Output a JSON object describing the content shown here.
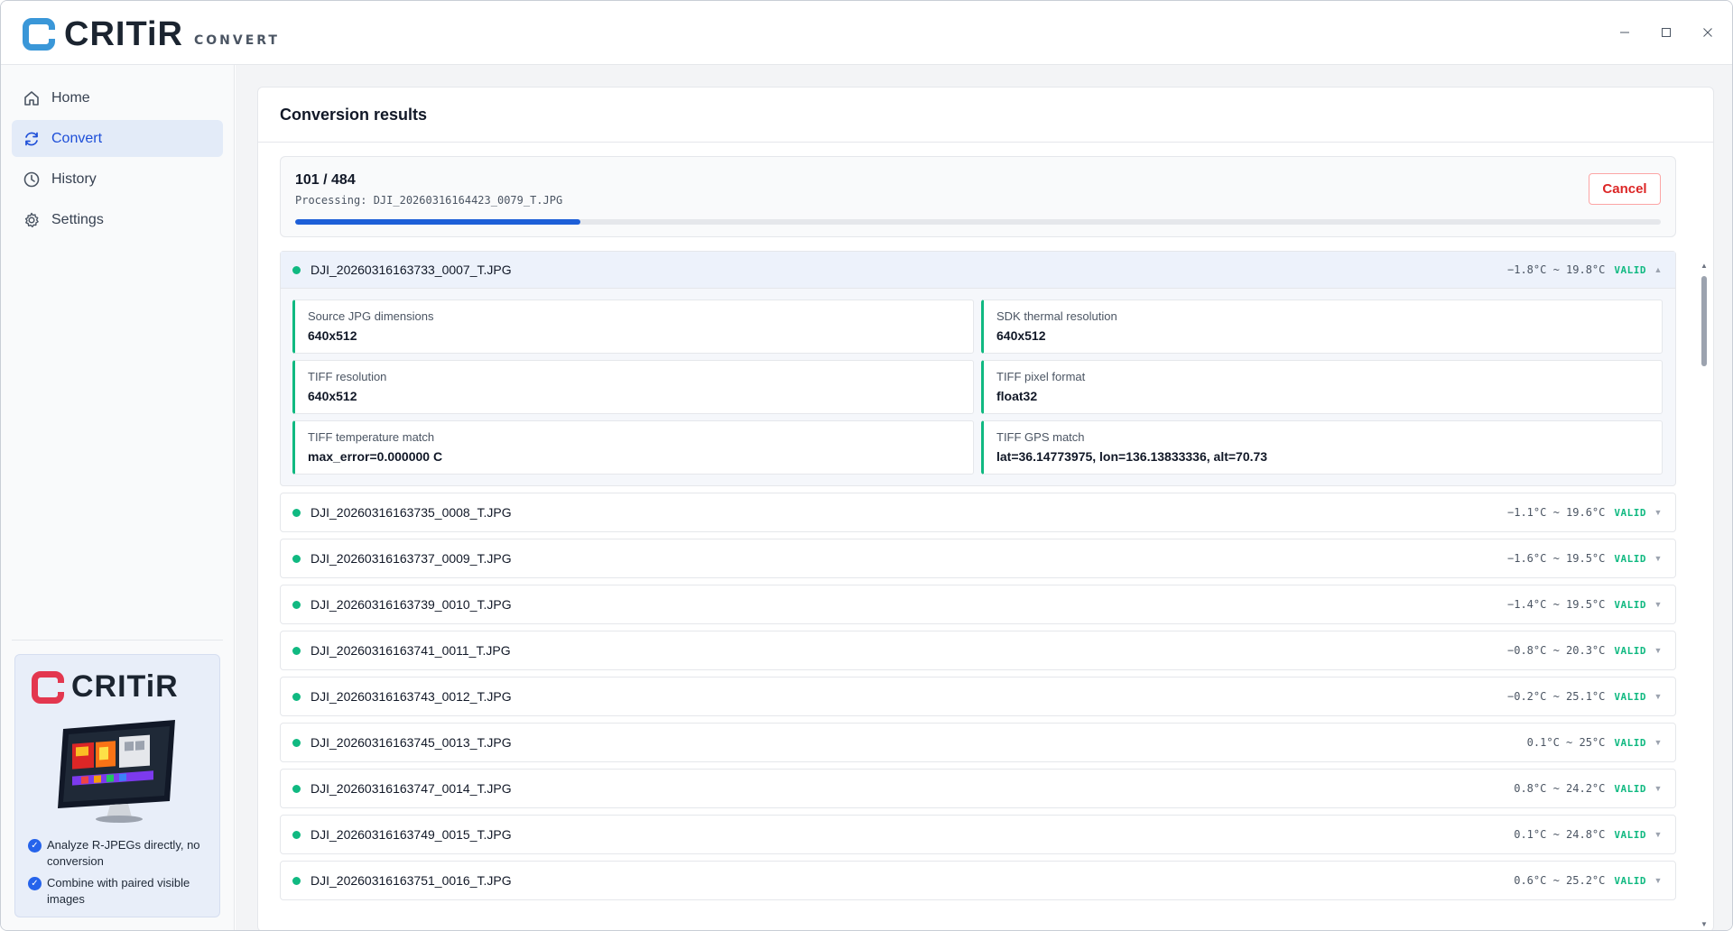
{
  "app": {
    "name": "CRITiR",
    "subtitle": "CONVERT",
    "window_controls": [
      "minimize-icon",
      "maximize-icon",
      "close-icon"
    ]
  },
  "sidebar": {
    "items": [
      {
        "label": "Home",
        "icon": "home-icon",
        "active": false
      },
      {
        "label": "Convert",
        "icon": "refresh-icon",
        "active": true
      },
      {
        "label": "History",
        "icon": "clock-icon",
        "active": false
      },
      {
        "label": "Settings",
        "icon": "gear-icon",
        "active": false
      }
    ],
    "promo": {
      "brand": "CRITiR",
      "features": [
        "Analyze R-JPEGs directly, no conversion",
        "Combine with paired visible images"
      ]
    }
  },
  "main": {
    "title": "Conversion results",
    "progress": {
      "count": "101 / 484",
      "file": "Processing: DJI_20260316164423_0079_T.JPG",
      "fraction": 0.2087,
      "cancel_label": "Cancel"
    },
    "expanded": {
      "file": "DJI_20260316163733_0007_T.JPG",
      "temp": "−1.8°C ~ 19.8°C",
      "status": "VALID",
      "details": [
        {
          "label": "Source JPG dimensions",
          "value": "640x512"
        },
        {
          "label": "SDK thermal resolution",
          "value": "640x512"
        },
        {
          "label": "TIFF resolution",
          "value": "640x512"
        },
        {
          "label": "TIFF pixel format",
          "value": "float32"
        },
        {
          "label": "TIFF temperature match",
          "value": "max_error=0.000000 C"
        },
        {
          "label": "TIFF GPS match",
          "value": "lat=36.14773975, lon=136.13833336, alt=70.73"
        }
      ]
    },
    "rows": [
      {
        "file": "DJI_20260316163735_0008_T.JPG",
        "temp": "−1.1°C ~ 19.6°C",
        "status": "VALID"
      },
      {
        "file": "DJI_20260316163737_0009_T.JPG",
        "temp": "−1.6°C ~ 19.5°C",
        "status": "VALID"
      },
      {
        "file": "DJI_20260316163739_0010_T.JPG",
        "temp": "−1.4°C ~ 19.5°C",
        "status": "VALID"
      },
      {
        "file": "DJI_20260316163741_0011_T.JPG",
        "temp": "−0.8°C ~ 20.3°C",
        "status": "VALID"
      },
      {
        "file": "DJI_20260316163743_0012_T.JPG",
        "temp": "−0.2°C ~ 25.1°C",
        "status": "VALID"
      },
      {
        "file": "DJI_20260316163745_0013_T.JPG",
        "temp": "0.1°C ~ 25°C",
        "status": "VALID"
      },
      {
        "file": "DJI_20260316163747_0014_T.JPG",
        "temp": "0.8°C ~ 24.2°C",
        "status": "VALID"
      },
      {
        "file": "DJI_20260316163749_0015_T.JPG",
        "temp": "0.1°C ~ 24.8°C",
        "status": "VALID"
      },
      {
        "file": "DJI_20260316163751_0016_T.JPG",
        "temp": "0.6°C ~ 25.2°C",
        "status": "VALID"
      }
    ],
    "colors": {
      "accent": "#1d5fd8",
      "valid": "#10b981",
      "cancel": "#dc2626"
    }
  }
}
